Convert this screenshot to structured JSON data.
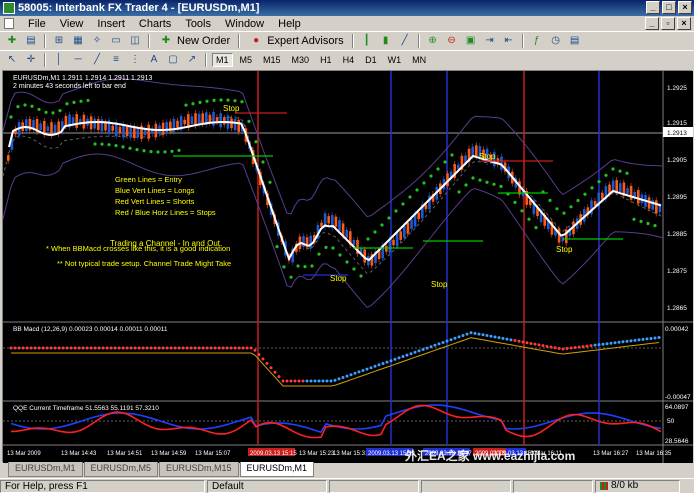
{
  "window": {
    "title": "58005: Interbank FX Trader 4 - [EURUSDm,M1]"
  },
  "menu": [
    "File",
    "View",
    "Insert",
    "Charts",
    "Tools",
    "Window",
    "Help"
  ],
  "toolbar": {
    "new_order": "New Order",
    "expert_advisors": "Expert Advisors",
    "timeframes": [
      "M1",
      "M5",
      "M15",
      "M30",
      "H1",
      "H4",
      "D1",
      "W1",
      "MN"
    ],
    "active_timeframe": "M1"
  },
  "chart": {
    "header": "EURUSDm,M1  1.2911 1.2914 1.2911 1.2913",
    "subheader": "2 minutes 43 seconds left to bar end",
    "price_axis": [
      "1.2925",
      "1.2915",
      "1.2905",
      "1.2895",
      "1.2885",
      "1.2875",
      "1.2865"
    ],
    "current_price": "1.2913",
    "legend": [
      "Green Lines = Entry",
      "Blue Vert Lines = Longs",
      "Red Vert Lines = Shorts",
      "Red / Blue Horz Lines = Stops"
    ],
    "trading_note": "Trading a Channel - In and Out.",
    "note_1": "* When BBMacd crosses like this, it is a good indication",
    "note_2": "** Not typical trade setup. Channel Trade Might Take",
    "stop_label": "Stop",
    "bbmacd_header": "BB Macd (12,26,9) 0.00023 0.00014 0.00011 0.00011",
    "bbmacd_axis": [
      "0.00042",
      "-0.00047"
    ],
    "qqe_header": "QQE Current Timeframe 51.5563 55.1191 57.3210",
    "qqe_axis": [
      "64.0897",
      "50",
      "28.5646"
    ],
    "time_axis": [
      "13 Mar 2009",
      "13 Mar 14:43",
      "13 Mar 14:51",
      "13 Mar 14:59",
      "13 Mar 15:07",
      "13 Mar 15:23",
      "13 Mar 15:31",
      "13 Mar 16:11",
      "13 Mar 16:27",
      "13 Mar 16:35"
    ],
    "time_highlights": [
      "2009.03.13 15:15",
      "2009.03.13 15:39",
      "2009.03.13 15:47",
      "2009.03.13 15:55",
      "2009.03.13 16:03"
    ],
    "watermark": "外汇EA之家 www.eazhijia.com",
    "colors": {
      "bull": "#1e5ad2",
      "bear": "#ff5a14",
      "entry": "#00c800",
      "dots": "#22c022",
      "long": "#2030d0",
      "short": "#c81e1e",
      "text": "#ffff00"
    }
  },
  "tabs": [
    "EURUSDm,M1",
    "EURUSDm,M5",
    "EURUSDm,M15",
    "EURUSDm,M1"
  ],
  "active_tab": 3,
  "status": {
    "help": "For Help, press F1",
    "profile": "Default",
    "traffic": "8/0 kb"
  }
}
